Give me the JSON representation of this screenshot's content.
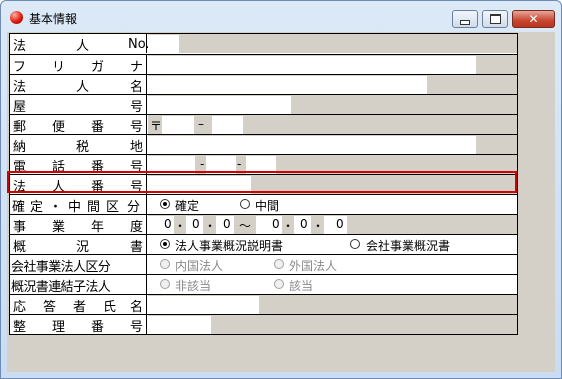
{
  "window": {
    "title": "基本情報"
  },
  "rows": [
    {
      "label_chars": [
        "法",
        "人",
        "No."
      ]
    },
    {
      "label_chars": [
        "フ",
        "リ",
        "ガ",
        "ナ"
      ]
    },
    {
      "label_chars": [
        "法",
        "人",
        "名"
      ]
    },
    {
      "label_chars": [
        "屋",
        "号"
      ]
    },
    {
      "label_chars": [
        "郵",
        "便",
        "番",
        "号"
      ],
      "postal_mark": "〒",
      "dash": "–"
    },
    {
      "label_chars": [
        "納",
        "税",
        "地"
      ]
    },
    {
      "label_chars": [
        "電",
        "話",
        "番",
        "号"
      ],
      "dash1": "-",
      "dash2": "-"
    },
    {
      "label_chars": [
        "法",
        "人",
        "番",
        "号"
      ]
    },
    {
      "label_chars": [
        "確",
        "定",
        "・",
        "中",
        "間",
        "区",
        "分"
      ],
      "options": [
        "確定",
        "中間"
      ],
      "selected": "確定"
    },
    {
      "label_chars": [
        "事",
        "業",
        "年",
        "度"
      ],
      "date_from": [
        "0",
        "0",
        "0"
      ],
      "date_to": [
        "0",
        "0",
        "0"
      ],
      "range_sep": "〜",
      "dot": "・"
    },
    {
      "label_chars": [
        "概",
        "況",
        "書"
      ],
      "options": [
        "法人事業概況説明書",
        "会社事業概況書"
      ],
      "selected": "法人事業概況説明書"
    },
    {
      "label": "会社事業法人区分",
      "options": [
        "内国法人",
        "外国法人"
      ],
      "disabled": true
    },
    {
      "label": "概況書連結子法人",
      "options": [
        "非該当",
        "該当"
      ],
      "disabled": true
    },
    {
      "label_chars": [
        "応",
        "答",
        "者",
        "氏",
        "名"
      ]
    },
    {
      "label_chars": [
        "整",
        "理",
        "番",
        "号"
      ]
    }
  ]
}
